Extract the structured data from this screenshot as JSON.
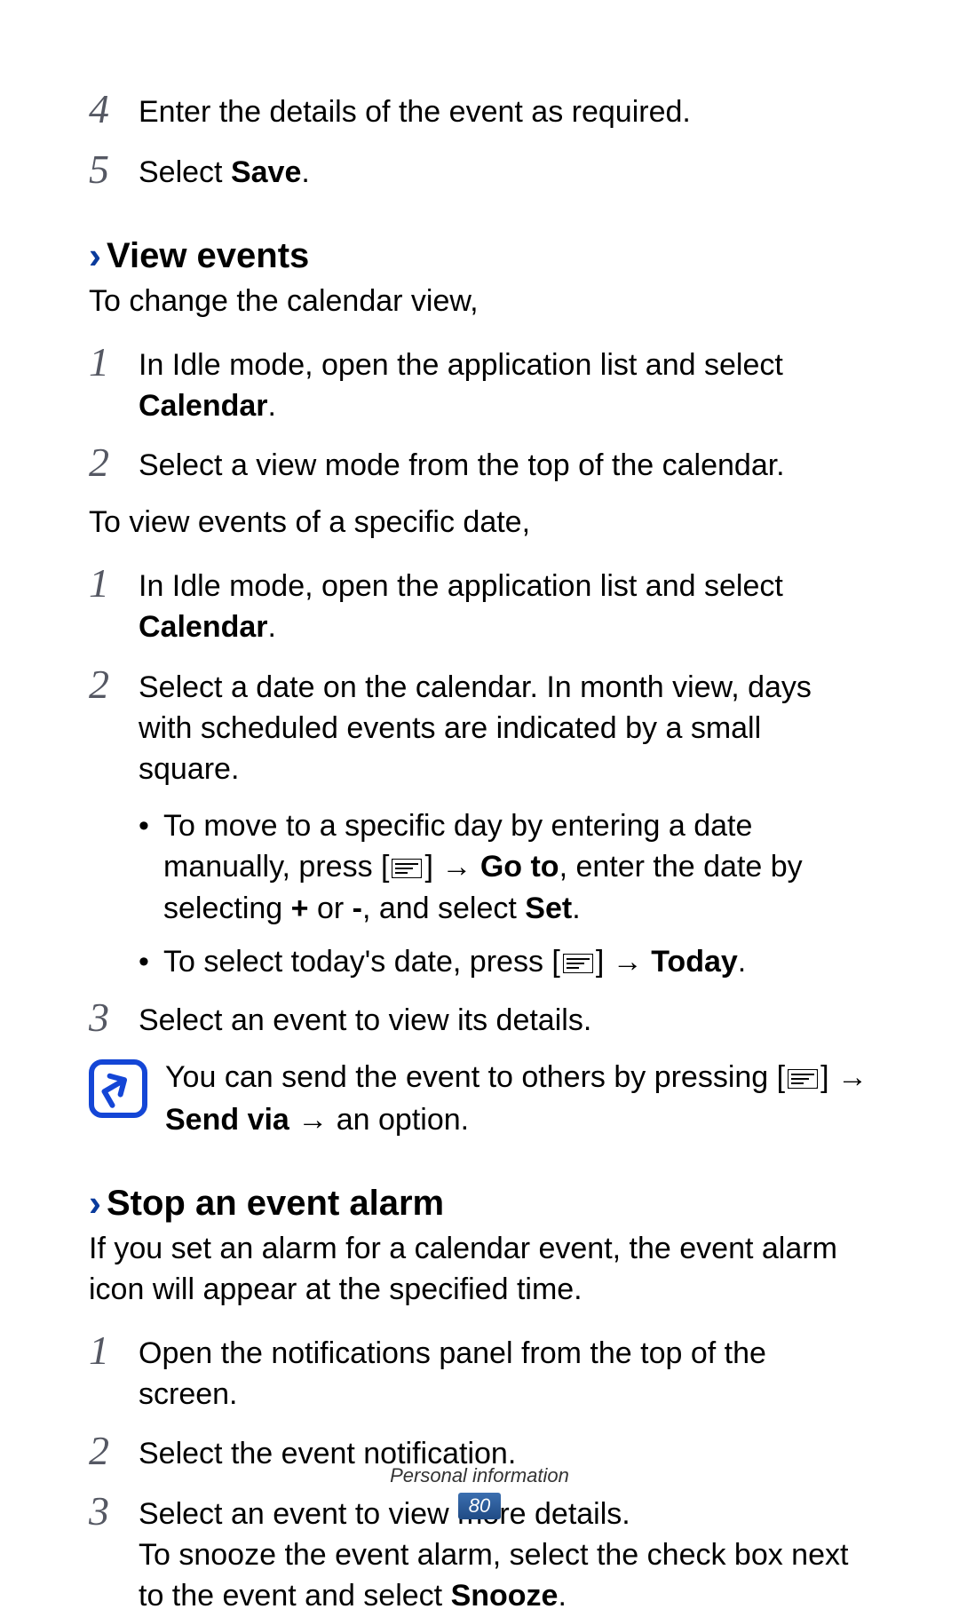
{
  "steps_top": [
    {
      "num": "4",
      "text": "Enter the details of the event as required."
    },
    {
      "num": "5",
      "text_pre": "Select ",
      "text_bold": "Save",
      "text_post": "."
    }
  ],
  "section_view": {
    "chevron": "›",
    "title": "View events",
    "intro": "To change the calendar view,",
    "steps_a": [
      {
        "num": "1",
        "text_pre": "In Idle mode, open the application list and select ",
        "text_bold": "Calendar",
        "text_post": "."
      },
      {
        "num": "2",
        "text": "Select a view mode from the top of the calendar."
      }
    ],
    "para": "To view events of a specific date,",
    "steps_b": {
      "s1": {
        "num": "1",
        "text_pre": "In Idle mode, open the application list and select ",
        "text_bold": "Calendar",
        "text_post": "."
      },
      "s2": {
        "num": "2",
        "text": "Select a date on the calendar. In month view, days with scheduled events are indicated by a small square."
      },
      "b1": {
        "pre": "To move to a specific day by entering a date manually, press [",
        "mid1": "] → ",
        "goto": "Go to",
        "mid2": ", enter the date by selecting ",
        "plus": "+",
        "mid3": " or ",
        "minus": "-",
        "mid4": ", and select ",
        "set": "Set",
        "post": "."
      },
      "b2": {
        "pre": "To select today's date, press [",
        "mid": "] → ",
        "today": "Today",
        "post": "."
      },
      "s3": {
        "num": "3",
        "text": "Select an event to view its details."
      }
    },
    "note": {
      "pre": "You can send the event to others by pressing [",
      "mid": "] → ",
      "sendvia": "Send via",
      "post": " → an option."
    }
  },
  "section_stop": {
    "chevron": "›",
    "title": "Stop an event alarm",
    "intro": "If you set an alarm for a calendar event, the event alarm icon will appear at the specified time.",
    "steps": {
      "s1": {
        "num": "1",
        "text": "Open the notifications panel from the top of the screen."
      },
      "s2": {
        "num": "2",
        "text": "Select the event notification."
      },
      "s3": {
        "num": "3",
        "text": "Select an event to view more details.",
        "extra_pre": "To snooze the event alarm, select the check box next to the event and select ",
        "extra_bold": "Snooze",
        "extra_post": "."
      }
    }
  },
  "footer": {
    "label": "Personal information",
    "page": "80"
  }
}
